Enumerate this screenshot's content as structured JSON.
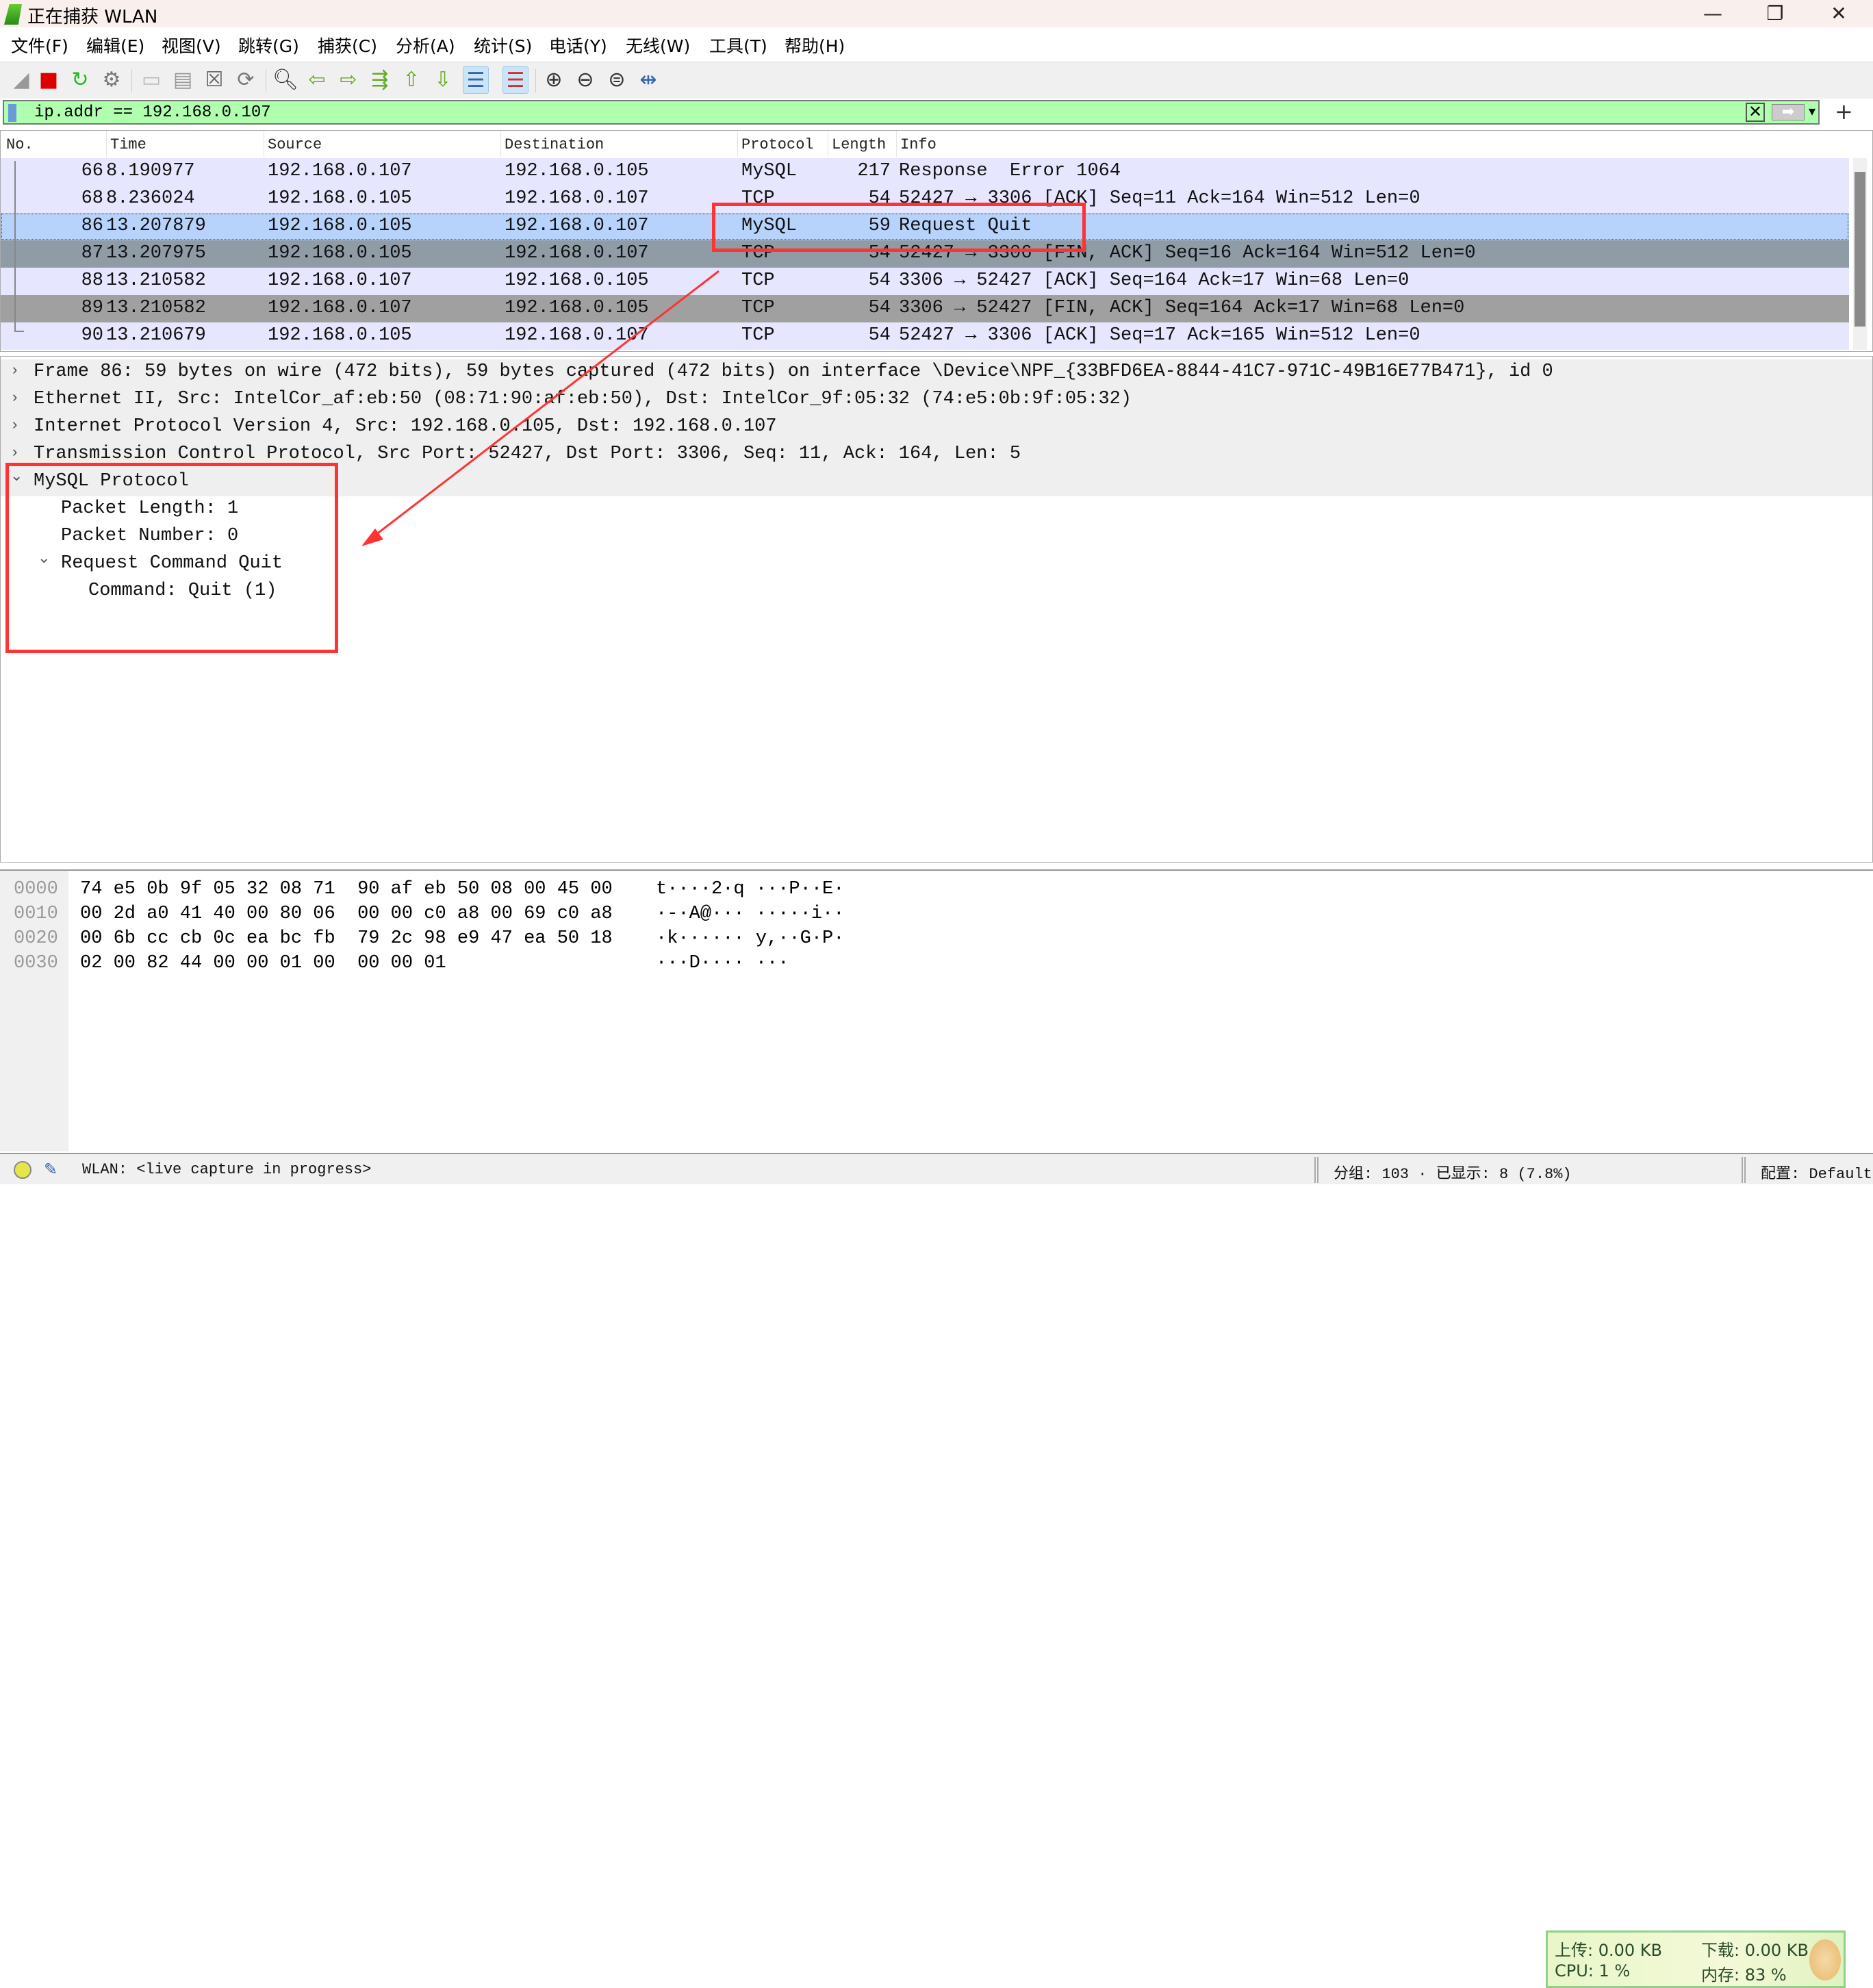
{
  "window": {
    "title": "正在捕获 WLAN",
    "controls": [
      "minimize",
      "restore",
      "close"
    ]
  },
  "menu": [
    "文件(F)",
    "编辑(E)",
    "视图(V)",
    "跳转(G)",
    "捕获(C)",
    "分析(A)",
    "统计(S)",
    "电话(Y)",
    "无线(W)",
    "工具(T)",
    "帮助(H)"
  ],
  "filter": {
    "value": "ip.addr == 192.168.0.107"
  },
  "packet_list": {
    "columns": [
      "No.",
      "Time",
      "Source",
      "Destination",
      "Protocol",
      "Length",
      "Info"
    ],
    "rows": [
      {
        "no": "66",
        "time": "8.190977",
        "src": "192.168.0.107",
        "dst": "192.168.0.105",
        "proto": "MySQL",
        "len": "217",
        "info": "Response  Error 1064",
        "style": "normal"
      },
      {
        "no": "68",
        "time": "8.236024",
        "src": "192.168.0.105",
        "dst": "192.168.0.107",
        "proto": "TCP",
        "len": "54",
        "info": "52427 → 3306 [ACK] Seq=11 Ack=164 Win=512 Len=0",
        "style": "normal"
      },
      {
        "no": "86",
        "time": "13.207879",
        "src": "192.168.0.105",
        "dst": "192.168.0.107",
        "proto": "MySQL",
        "len": "59",
        "info": "Request Quit",
        "style": "selected"
      },
      {
        "no": "87",
        "time": "13.207975",
        "src": "192.168.0.105",
        "dst": "192.168.0.107",
        "proto": "TCP",
        "len": "54",
        "info": "52427 → 3306 [FIN, ACK] Seq=16 Ack=164 Win=512 Len=0",
        "style": "fin"
      },
      {
        "no": "88",
        "time": "13.210582",
        "src": "192.168.0.107",
        "dst": "192.168.0.105",
        "proto": "TCP",
        "len": "54",
        "info": "3306 → 52427 [ACK] Seq=164 Ack=17 Win=68 Len=0",
        "style": "normal"
      },
      {
        "no": "89",
        "time": "13.210582",
        "src": "192.168.0.107",
        "dst": "192.168.0.105",
        "proto": "TCP",
        "len": "54",
        "info": "3306 → 52427 [FIN, ACK] Seq=164 Ack=17 Win=68 Len=0",
        "style": "fin2"
      },
      {
        "no": "90",
        "time": "13.210679",
        "src": "192.168.0.105",
        "dst": "192.168.0.107",
        "proto": "TCP",
        "len": "54",
        "info": "52427 → 3306 [ACK] Seq=17 Ack=165 Win=512 Len=0",
        "style": "normal"
      }
    ],
    "row_colors": {
      "normal": "#e7e6ff",
      "selected": "#b8d3fb",
      "fin": "#8f9ca6",
      "fin2": "#a0a0a0"
    }
  },
  "details": [
    {
      "text": "Frame 86: 59 bytes on wire (472 bits), 59 bytes captured (472 bits) on interface \\Device\\NPF_{33BFD6EA-8844-41C7-971C-49B16E77B471}, id 0",
      "indent": 0,
      "expander": "collapsed"
    },
    {
      "text": "Ethernet II, Src: IntelCor_af:eb:50 (08:71:90:af:eb:50), Dst: IntelCor_9f:05:32 (74:e5:0b:9f:05:32)",
      "indent": 0,
      "expander": "collapsed"
    },
    {
      "text": "Internet Protocol Version 4, Src: 192.168.0.105, Dst: 192.168.0.107",
      "indent": 0,
      "expander": "collapsed"
    },
    {
      "text": "Transmission Control Protocol, Src Port: 52427, Dst Port: 3306, Seq: 11, Ack: 164, Len: 5",
      "indent": 0,
      "expander": "collapsed"
    },
    {
      "text": "MySQL Protocol",
      "indent": 0,
      "expander": "expanded"
    },
    {
      "text": "Packet Length: 1",
      "indent": 1,
      "expander": "none"
    },
    {
      "text": "Packet Number: 0",
      "indent": 1,
      "expander": "none"
    },
    {
      "text": "Request Command Quit",
      "indent": 1,
      "expander": "expanded"
    },
    {
      "text": "Command: Quit (1)",
      "indent": 2,
      "expander": "none"
    }
  ],
  "bytes": [
    {
      "offset": "0000",
      "hex": "74 e5 0b 9f 05 32 08 71  90 af eb 50 08 00 45 00",
      "ascii": "t····2·q ···P··E·"
    },
    {
      "offset": "0010",
      "hex": "00 2d a0 41 40 00 80 06  00 00 c0 a8 00 69 c0 a8",
      "ascii": "·-·A@··· ·····i··"
    },
    {
      "offset": "0020",
      "hex": "00 6b cc cb 0c ea bc fb  79 2c 98 e9 47 ea 50 18",
      "ascii": "·k······ y,··G·P·"
    },
    {
      "offset": "0030",
      "hex": "02 00 82 44 00 00 01 00  00 00 01",
      "ascii": "···D···· ···"
    }
  ],
  "widget": {
    "upload": "上传: 0.00 KB",
    "download": "下载: 0.00 KB",
    "cpu": "CPU: 1 %",
    "memory": "内存: 83 %"
  },
  "status": {
    "capture": "WLAN: <live capture in progress>",
    "packets": "分组: 103 · 已显示: 8 (7.8%)",
    "profile": "配置: Default"
  },
  "annotation_color": "#ff3333"
}
